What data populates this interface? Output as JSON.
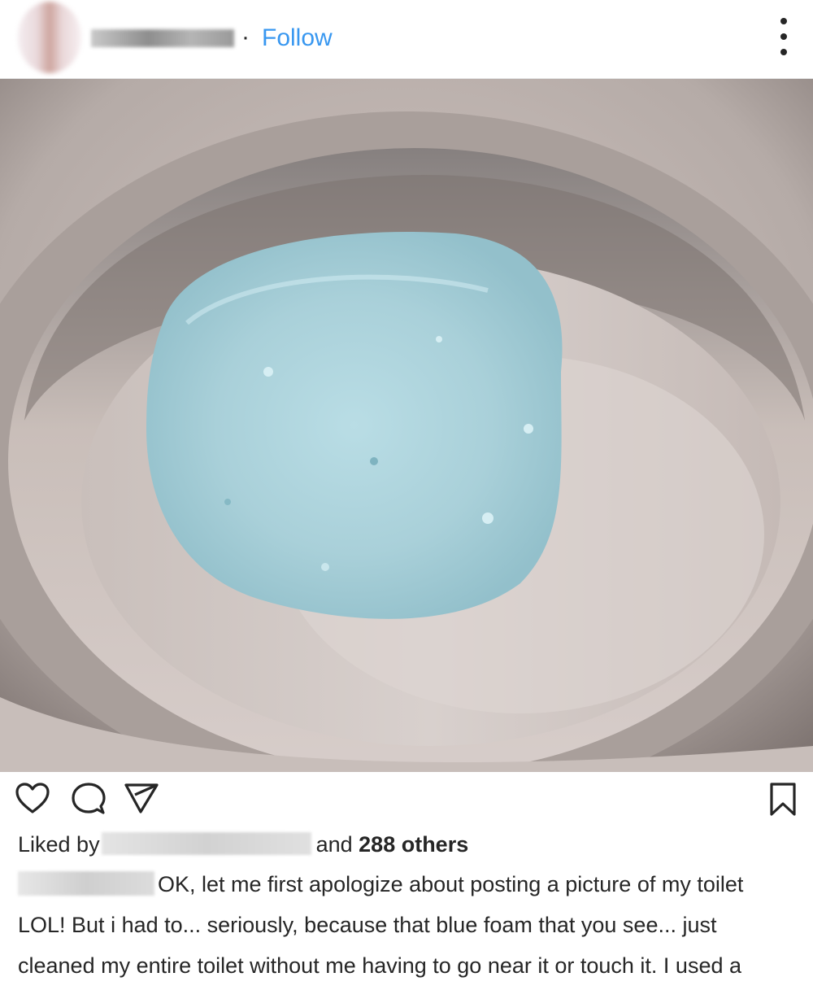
{
  "header": {
    "separator": "·",
    "follow_label": "Follow"
  },
  "post": {
    "liked_by_prefix": "Liked by",
    "liked_by_suffix": "and",
    "liked_by_count": "288 others",
    "caption": "OK, let me first apologize about posting a picture of my toilet LOL! But i had to... seriously, because that blue foam that you see... just cleaned my entire toilet without me having to go near it or touch it. I used a"
  },
  "icons": {
    "like": "heart-icon",
    "comment": "comment-icon",
    "share": "send-icon",
    "save": "bookmark-icon",
    "more": "more-options-icon"
  },
  "colors": {
    "accent": "#3897f0",
    "text": "#262626",
    "foam": "#a9d0d9"
  }
}
